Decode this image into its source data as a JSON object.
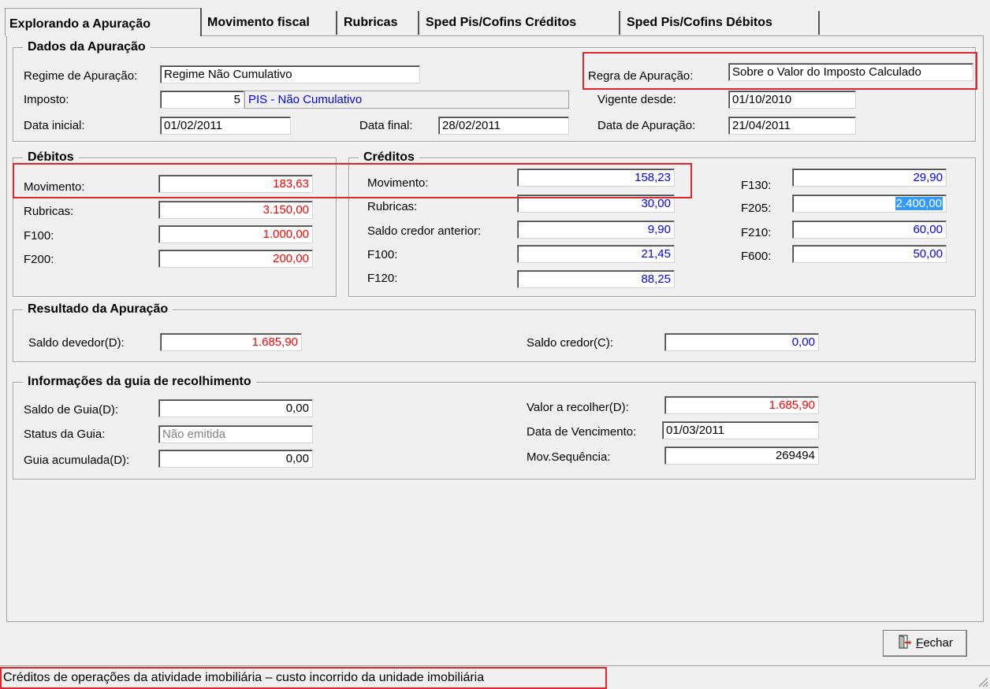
{
  "tabs": [
    {
      "label": "Explorando a Apuração",
      "active": true
    },
    {
      "label": "Movimento fiscal"
    },
    {
      "label": "Rubricas"
    },
    {
      "label": "Sped Pis/Cofins Créditos"
    },
    {
      "label": "Sped Pis/Cofins Débitos"
    }
  ],
  "dados": {
    "title": "Dados da Apuração",
    "regime_label": "Regime de Apuração:",
    "regime_value": "Regime Não Cumulativo",
    "regra_label": "Regra de Apuração:",
    "regra_value": "Sobre o Valor do Imposto Calculado",
    "imposto_label": "Imposto:",
    "imposto_code": "5",
    "imposto_desc": "PIS  - Não Cumulativo",
    "vigente_label": "Vigente desde:",
    "vigente_value": "01/10/2010",
    "data_inicial_label": "Data inicial:",
    "data_inicial_value": "01/02/2011",
    "data_final_label": "Data final:",
    "data_final_value": "28/02/2011",
    "data_apuracao_label": "Data de Apuração:",
    "data_apuracao_value": "21/04/2011"
  },
  "debitos": {
    "title": "Débitos",
    "rows": [
      {
        "label": "Movimento:",
        "value": "183,63"
      },
      {
        "label": "Rubricas:",
        "value": "3.150,00"
      },
      {
        "label": "F100:",
        "value": "1.000,00"
      },
      {
        "label": "F200:",
        "value": "200,00"
      }
    ]
  },
  "creditos": {
    "title": "Créditos",
    "left": [
      {
        "label": "Movimento:",
        "value": "158,23"
      },
      {
        "label": "Rubricas:",
        "value": "30,00"
      },
      {
        "label": "Saldo credor anterior:",
        "value": "9,90"
      },
      {
        "label": "F100:",
        "value": "21,45"
      },
      {
        "label": "F120:",
        "value": "88,25"
      }
    ],
    "right": [
      {
        "label": "F130:",
        "value": "29,90"
      },
      {
        "label": "F205:",
        "value": "2.400,00"
      },
      {
        "label": "F210:",
        "value": "60,00"
      },
      {
        "label": "F600:",
        "value": "50,00"
      }
    ]
  },
  "resultado": {
    "title": "Resultado da Apuração",
    "devedor_label": "Saldo devedor(D):",
    "devedor_value": "1.685,90",
    "credor_label": "Saldo credor(C):",
    "credor_value": "0,00"
  },
  "guia": {
    "title": "Informações da guia de recolhimento",
    "saldo_label": "Saldo de Guia(D):",
    "saldo_value": "0,00",
    "status_label": "Status da Guia:",
    "status_value": "Não emitida",
    "acumulada_label": "Guia acumulada(D):",
    "acumulada_value": "0,00",
    "valor_label": "Valor a recolher(D):",
    "valor_value": "1.685,90",
    "venc_label": "Data de Vencimento:",
    "venc_value": "01/03/2011",
    "seq_label": "Mov.Sequência:",
    "seq_value": "269494"
  },
  "footer": {
    "close_prefix": "",
    "close_accel": "F",
    "close_rest": "echar",
    "status_text": "Créditos de operações da atividade imobiliária – custo incorrido da unidade imobiliária"
  },
  "colors": {
    "debit": "#ff0000",
    "credit": "#0000ff",
    "highlight": "#e0262b"
  },
  "icons": {
    "close_button_icon": "door-exit-icon",
    "size_grip": "size-grip-icon"
  }
}
